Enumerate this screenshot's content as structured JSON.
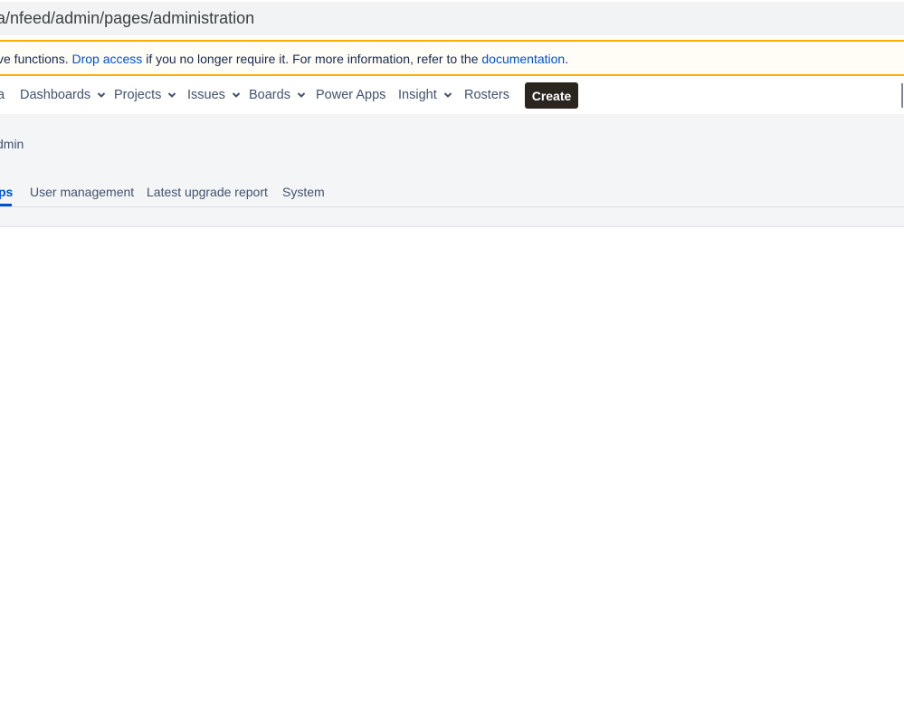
{
  "browser": {
    "url_fragment": "a/nfeed/admin/pages/administration"
  },
  "banner": {
    "text_start": "ve functions.",
    "link1": "Drop access",
    "text_middle": "if you no longer require it. For more information, refer to the",
    "link2": "documentation",
    "text_end": "."
  },
  "nav": {
    "partial_left": "a",
    "items": [
      {
        "label": "Dashboards",
        "dropdown": true
      },
      {
        "label": "Projects",
        "dropdown": true
      },
      {
        "label": "Issues",
        "dropdown": true
      },
      {
        "label": "Boards",
        "dropdown": true
      },
      {
        "label": "Power Apps",
        "dropdown": false
      },
      {
        "label": "Insight",
        "dropdown": true
      },
      {
        "label": "Rosters",
        "dropdown": false
      }
    ],
    "create_label": "Create"
  },
  "header": {
    "title_partial": "dmin"
  },
  "tabs": [
    {
      "label": "ps",
      "active": true
    },
    {
      "label": "User management",
      "active": false
    },
    {
      "label": "Latest upgrade report",
      "active": false
    },
    {
      "label": "System",
      "active": false
    }
  ],
  "colors": {
    "link": "#0052cc",
    "banner_border": "#ffab00",
    "create_bg": "#2b2520"
  }
}
